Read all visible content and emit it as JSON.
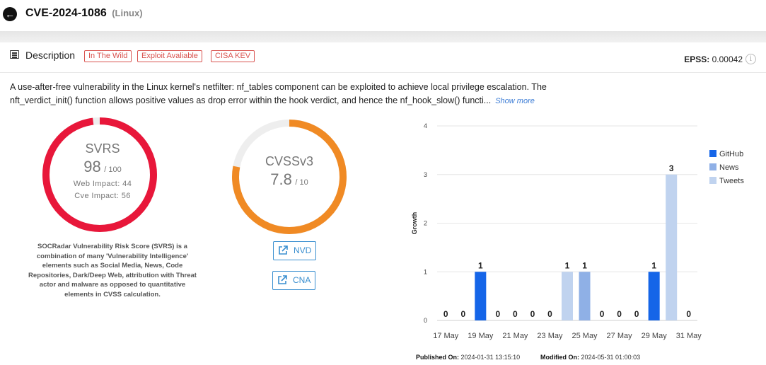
{
  "header": {
    "title": "CVE-2024-1086",
    "vendor": "(Linux)"
  },
  "description": {
    "label": "Description",
    "tags": [
      "In The Wild",
      "Exploit Avaliable",
      "CISA KEV"
    ],
    "epss_label": "EPSS:",
    "epss_value": "0.00042",
    "info_glyph": "i",
    "text_line1": "A use-after-free vulnerability in the Linux kernel's netfilter: nf_tables component can be exploited to achieve local privilege escalation. The",
    "text_line2": "nft_verdict_init() function allows positive values as drop error within the hook verdict, and hence the nf_hook_slow() functi...",
    "show_more": "Show more"
  },
  "svrs": {
    "title": "SVRS",
    "value": "98",
    "max": "/ 100",
    "fraction": 0.98,
    "web_impact": "Web Impact: 44",
    "cve_impact": "Cve Impact: 56",
    "color": "#e8173a",
    "note": "SOCRadar Vulnerability Risk Score (SVRS) is a combination of many 'Vulnerability Intelligence' elements such as Social Media, News, Code Repositories, Dark/Deep Web, attribution with Threat actor and malware as opposed to quantitative elements in CVSS calculation."
  },
  "cvss": {
    "title": "CVSSv3",
    "value": "7.8",
    "max": "/ 10",
    "fraction": 0.78,
    "color": "#f08a24",
    "track_color": "#eeeeee",
    "nvd_label": "NVD",
    "cna_label": "CNA"
  },
  "chart_data": {
    "type": "bar",
    "categories": [
      "17 May",
      "18 May",
      "19 May",
      "20 May",
      "21 May",
      "22 May",
      "23 May",
      "24 May",
      "25 May",
      "26 May",
      "27 May",
      "28 May",
      "29 May",
      "30 May",
      "31 May"
    ],
    "tick_labels": [
      "17 May",
      "19 May",
      "21 May",
      "23 May",
      "25 May",
      "27 May",
      "29 May",
      "31 May"
    ],
    "ylabel": "Growth",
    "ylim": [
      0,
      4
    ],
    "yticks": [
      "0",
      "1",
      "2",
      "3",
      "4"
    ],
    "grid": true,
    "legend": "right",
    "series": [
      {
        "name": "GitHub",
        "color": "#1565e8",
        "values": [
          0,
          0,
          1,
          0,
          0,
          0,
          0,
          0,
          0,
          0,
          0,
          0,
          1,
          0,
          0
        ]
      },
      {
        "name": "News",
        "color": "#8fb0e6",
        "values": [
          0,
          0,
          0,
          0,
          0,
          0,
          0,
          0,
          1,
          0,
          0,
          0,
          0,
          0,
          0
        ]
      },
      {
        "name": "Tweets",
        "color": "#c0d3ef",
        "values": [
          0,
          0,
          0,
          0,
          0,
          0,
          0,
          1,
          0,
          0,
          0,
          0,
          0,
          3,
          0
        ]
      }
    ],
    "totals": [
      0,
      0,
      1,
      0,
      0,
      0,
      0,
      1,
      1,
      0,
      0,
      0,
      1,
      3,
      0
    ]
  },
  "footer": {
    "published_label": "Published On:",
    "published_value": "2024-01-31 13:15:10",
    "modified_label": "Modified On:",
    "modified_value": "2024-05-31 01:00:03"
  },
  "icons": {
    "back": "arrow-left-icon",
    "description": "list-icon",
    "info": "info-icon",
    "external": "external-link-icon"
  }
}
